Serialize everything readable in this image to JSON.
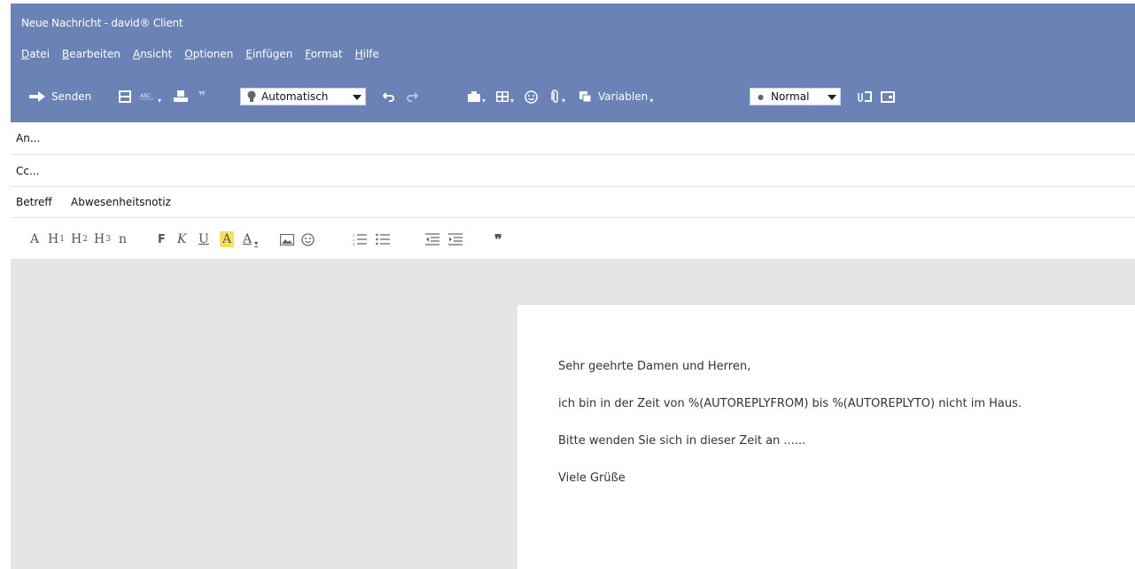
{
  "window": {
    "title": "Neue Nachricht - david® Client"
  },
  "menu": [
    "Datei",
    "Bearbeiten",
    "Ansicht",
    "Optionen",
    "Einfügen",
    "Format",
    "Hilfe"
  ],
  "toolbar": {
    "send_label": "Senden",
    "priority_value": "Automatisch",
    "variables_label": "Variablen",
    "style_value": "Normal"
  },
  "header": {
    "to_label": "An...",
    "cc_label": "Cc...",
    "subject_label": "Betreff",
    "subject_value": "Abwesenheitsnotiz"
  },
  "format_bar": {
    "a": "A",
    "h1": "H",
    "h1_sup": "1",
    "h2": "H",
    "h2_sup": "2",
    "h3": "H",
    "h3_sup": "3",
    "normal": "n",
    "bold": "F",
    "italic": "K",
    "underline": "U",
    "highlight": "A",
    "font_color": "A"
  },
  "body": {
    "lines": [
      "Sehr geehrte Damen und Herren,",
      "ich bin in der Zeit von %(AUTOREPLYFROM) bis %(AUTOREPLYTO) nicht im Haus.",
      "Bitte wenden Sie sich in dieser Zeit an ......",
      "Viele Grüße"
    ]
  },
  "colors": {
    "accent": "#6a82b6",
    "editor_bg": "#e5e5e5",
    "highlight": "#f5e15a"
  }
}
